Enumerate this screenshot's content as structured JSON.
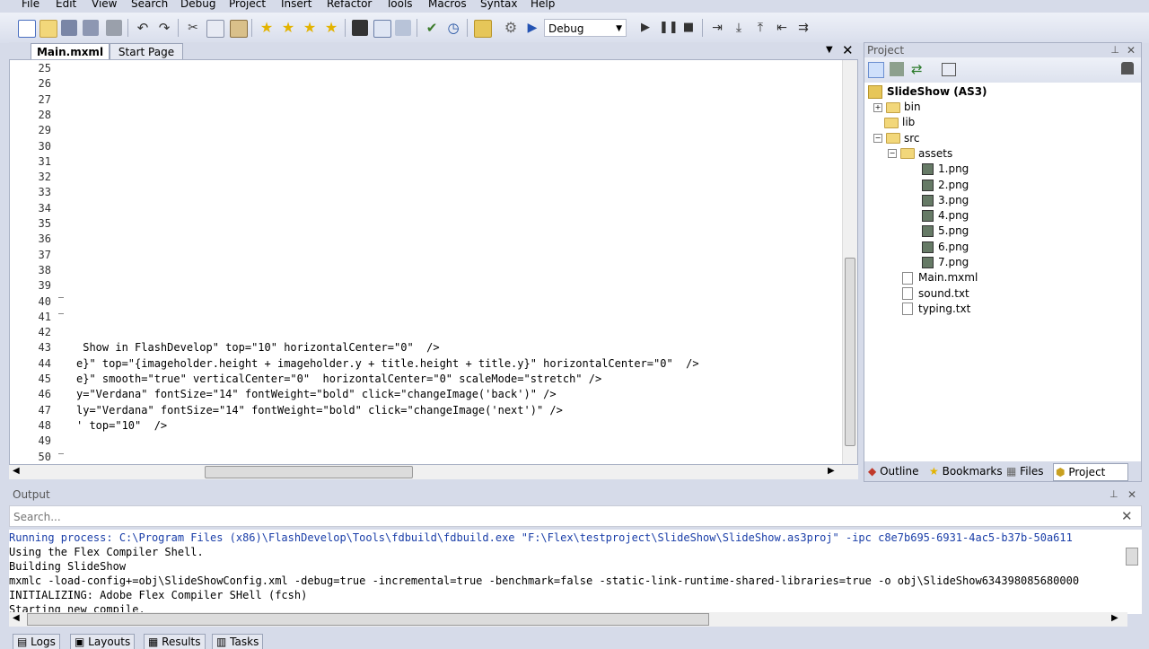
{
  "menu": [
    "File",
    "Edit",
    "View",
    "Search",
    "Debug",
    "Project",
    "Insert",
    "Refactor",
    "Tools",
    "Macros",
    "Syntax",
    "Help"
  ],
  "toolbar": {
    "config_select": "Debug"
  },
  "editor": {
    "tabs": [
      "Main.mxml",
      "Start Page"
    ],
    "lines": [
      {
        "n": "25",
        "code": ""
      },
      {
        "n": "26",
        "code": ""
      },
      {
        "n": "27",
        "code": ""
      },
      {
        "n": "28",
        "code": ""
      },
      {
        "n": "29",
        "code": ""
      },
      {
        "n": "30",
        "code": ""
      },
      {
        "n": "31",
        "code": ""
      },
      {
        "n": "32",
        "code": ""
      },
      {
        "n": "33",
        "code": ""
      },
      {
        "n": "34",
        "code": ""
      },
      {
        "n": "35",
        "code": ""
      },
      {
        "n": "36",
        "code": ""
      },
      {
        "n": "37",
        "code": ""
      },
      {
        "n": "38",
        "code": ""
      },
      {
        "n": "39",
        "code": ""
      },
      {
        "n": "40",
        "code": ""
      },
      {
        "n": "41",
        "code": ""
      },
      {
        "n": "42",
        "code": ""
      },
      {
        "n": "43",
        "code": " Show in FlashDevelop\" top=\"10\" horizontalCenter=\"0\"  />"
      },
      {
        "n": "44",
        "code": "e}\" top=\"{imageholder.height + imageholder.y + title.height + title.y}\" horizontalCenter=\"0\"  />"
      },
      {
        "n": "45",
        "code": "e}\" smooth=\"true\" verticalCenter=\"0\"  horizontalCenter=\"0\" scaleMode=\"stretch\" />"
      },
      {
        "n": "46",
        "code": "y=\"Verdana\" fontSize=\"14\" fontWeight=\"bold\" click=\"changeImage('back')\" />"
      },
      {
        "n": "47",
        "code": "ly=\"Verdana\" fontSize=\"14\" fontWeight=\"bold\" click=\"changeImage('next')\" />"
      },
      {
        "n": "48",
        "code": "' top=\"10\"  />"
      },
      {
        "n": "49",
        "code": ""
      },
      {
        "n": "50",
        "code": ""
      }
    ]
  },
  "project": {
    "title": "Project",
    "root": "SlideShow (AS3)",
    "tree": [
      {
        "label": "bin",
        "kind": "folder",
        "depth": 1,
        "toggle": "+"
      },
      {
        "label": "lib",
        "kind": "folder",
        "depth": 1,
        "toggle": ""
      },
      {
        "label": "src",
        "kind": "folder",
        "depth": 1,
        "toggle": "−"
      },
      {
        "label": "assets",
        "kind": "folder",
        "depth": 2,
        "toggle": "−"
      },
      {
        "label": "1.png",
        "kind": "png",
        "depth": 3
      },
      {
        "label": "2.png",
        "kind": "png",
        "depth": 3
      },
      {
        "label": "3.png",
        "kind": "png",
        "depth": 3
      },
      {
        "label": "4.png",
        "kind": "png",
        "depth": 3
      },
      {
        "label": "5.png",
        "kind": "png",
        "depth": 3
      },
      {
        "label": "6.png",
        "kind": "png",
        "depth": 3
      },
      {
        "label": "7.png",
        "kind": "png",
        "depth": 3
      },
      {
        "label": "Main.mxml",
        "kind": "doc",
        "depth": 2
      },
      {
        "label": "sound.txt",
        "kind": "doc",
        "depth": 2
      },
      {
        "label": "typing.txt",
        "kind": "doc",
        "depth": 2
      }
    ],
    "tabs": [
      "Outline",
      "Bookmarks",
      "Files",
      "Project"
    ]
  },
  "output": {
    "title": "Output",
    "search_placeholder": "Search...",
    "lines": [
      {
        "text": "Running process: C:\\Program Files (x86)\\FlashDevelop\\Tools\\fdbuild\\fdbuild.exe \"F:\\Flex\\testproject\\SlideShow\\SlideShow.as3proj\" -ipc c8e7b695-6931-4ac5-b37b-50a611",
        "color": "#1a3ea8"
      },
      {
        "text": "Using the Flex Compiler Shell.",
        "color": "#000000"
      },
      {
        "text": "Building SlideShow",
        "color": "#000000"
      },
      {
        "text": "mxmlc -load-config+=obj\\SlideShowConfig.xml -debug=true -incremental=true -benchmark=false -static-link-runtime-shared-libraries=true -o obj\\SlideShow634398085680000",
        "color": "#000000"
      },
      {
        "text": "INITIALIZING: Adobe Flex Compiler SHell (fcsh)",
        "color": "#000000"
      },
      {
        "text": "Starting new compile.",
        "color": "#000000"
      }
    ]
  },
  "bottom_tabs": [
    "Logs",
    "Layouts",
    "Results",
    "Tasks"
  ]
}
